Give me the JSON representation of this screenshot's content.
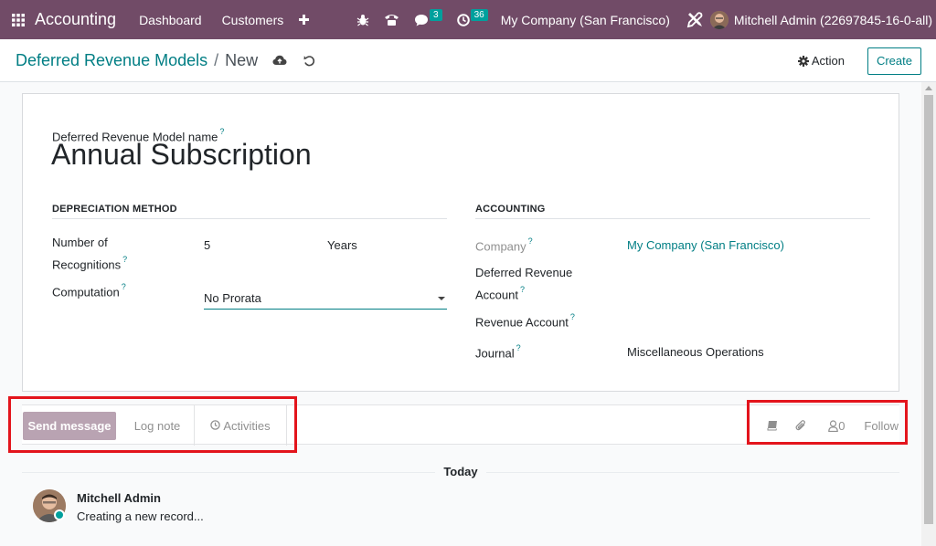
{
  "navbar": {
    "app_name": "Accounting",
    "menu": [
      "Dashboard",
      "Customers"
    ],
    "messages_count": "3",
    "activities_count": "36",
    "company": "My Company (San Francisco)",
    "user": "Mitchell Admin (22697845-16-0-all)"
  },
  "breadcrumb": {
    "parent": "Deferred Revenue Models",
    "separator": "/",
    "current": "New"
  },
  "control": {
    "action_label": "Action",
    "create_label": "Create"
  },
  "form": {
    "name_label": "Deferred Revenue Model name",
    "help_mark": "?",
    "name_value": "Annual Subscription",
    "depreciation": {
      "heading": "DEPRECIATION METHOD",
      "recognitions_label_1": "Number of",
      "recognitions_label_2": "Recognitions",
      "recognitions_value": "5",
      "recognitions_unit": "Years",
      "computation_label": "Computation",
      "computation_value": "No Prorata"
    },
    "accounting": {
      "heading": "ACCOUNTING",
      "company_label": "Company",
      "company_value": "My Company (San Francisco)",
      "deferred_label_1": "Deferred Revenue",
      "deferred_label_2": "Account",
      "revenue_label": "Revenue Account",
      "journal_label": "Journal",
      "journal_value": "Miscellaneous Operations"
    }
  },
  "chatter": {
    "send_message": "Send message",
    "log_note": "Log note",
    "activities": "Activities",
    "followers_count": "0",
    "follow": "Follow",
    "today": "Today",
    "message": {
      "author": "Mitchell Admin",
      "body": "Creating a new record..."
    }
  },
  "colors": {
    "navbar": "#714B67",
    "link": "#017E84",
    "badge": "#00A09D",
    "highlight": "#e3141c"
  }
}
